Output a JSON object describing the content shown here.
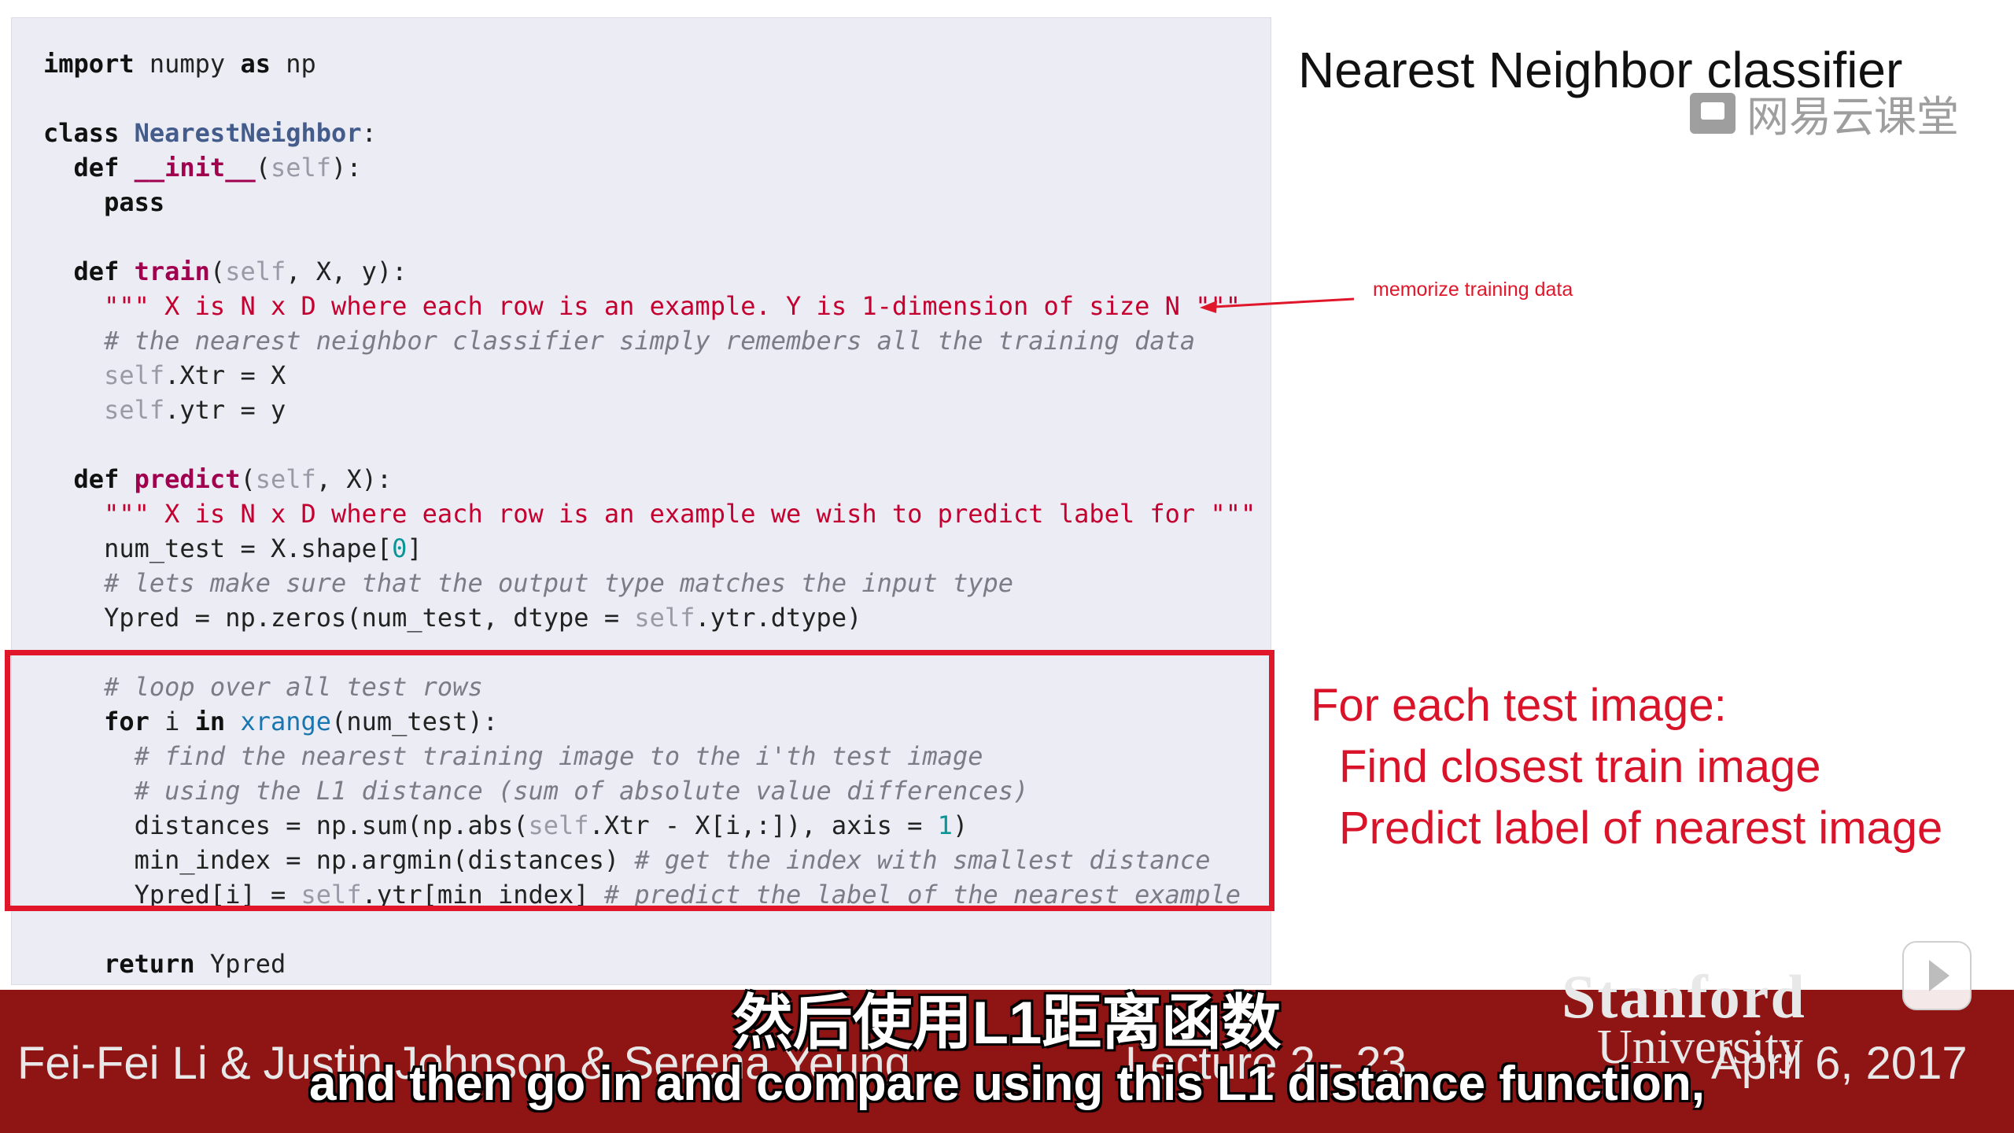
{
  "slide": {
    "title": "Nearest Neighbor classifier",
    "watermark": "网易云课堂",
    "annotation": "memorize training data",
    "side_note": [
      "For each test image:",
      "Find closest train image",
      "Predict label of nearest image"
    ]
  },
  "code_lines": [
    [
      {
        "t": "import",
        "c": "kw"
      },
      {
        "t": " numpy ",
        "c": ""
      },
      {
        "t": "as",
        "c": "kw"
      },
      {
        "t": " np",
        "c": ""
      }
    ],
    [],
    [
      {
        "t": "class",
        "c": "kw"
      },
      {
        "t": " ",
        "c": ""
      },
      {
        "t": "NearestNeighbor",
        "c": "cls"
      },
      {
        "t": ":",
        "c": ""
      }
    ],
    [
      {
        "t": "  ",
        "c": ""
      },
      {
        "t": "def",
        "c": "kw"
      },
      {
        "t": " ",
        "c": ""
      },
      {
        "t": "__init__",
        "c": "fn"
      },
      {
        "t": "(",
        "c": ""
      },
      {
        "t": "self",
        "c": "slf"
      },
      {
        "t": "):",
        "c": ""
      }
    ],
    [
      {
        "t": "    ",
        "c": ""
      },
      {
        "t": "pass",
        "c": "kw"
      }
    ],
    [],
    [
      {
        "t": "  ",
        "c": ""
      },
      {
        "t": "def",
        "c": "kw"
      },
      {
        "t": " ",
        "c": ""
      },
      {
        "t": "train",
        "c": "fn"
      },
      {
        "t": "(",
        "c": ""
      },
      {
        "t": "self",
        "c": "slf"
      },
      {
        "t": ", X, y):",
        "c": ""
      }
    ],
    [
      {
        "t": "    ",
        "c": ""
      },
      {
        "t": "\"\"\" X is N x D where each row is an example. Y is 1-dimension of size N \"\"\"",
        "c": "str"
      }
    ],
    [
      {
        "t": "    ",
        "c": ""
      },
      {
        "t": "# the nearest neighbor classifier simply remembers all the training data",
        "c": "cmt"
      }
    ],
    [
      {
        "t": "    ",
        "c": ""
      },
      {
        "t": "self",
        "c": "slf"
      },
      {
        "t": ".Xtr = X",
        "c": ""
      }
    ],
    [
      {
        "t": "    ",
        "c": ""
      },
      {
        "t": "self",
        "c": "slf"
      },
      {
        "t": ".ytr = y",
        "c": ""
      }
    ],
    [],
    [
      {
        "t": "  ",
        "c": ""
      },
      {
        "t": "def",
        "c": "kw"
      },
      {
        "t": " ",
        "c": ""
      },
      {
        "t": "predict",
        "c": "fn"
      },
      {
        "t": "(",
        "c": ""
      },
      {
        "t": "self",
        "c": "slf"
      },
      {
        "t": ", X):",
        "c": ""
      }
    ],
    [
      {
        "t": "    ",
        "c": ""
      },
      {
        "t": "\"\"\" X is N x D where each row is an example we wish to predict label for \"\"\"",
        "c": "str"
      }
    ],
    [
      {
        "t": "    num_test = X.shape[",
        "c": ""
      },
      {
        "t": "0",
        "c": "num"
      },
      {
        "t": "]",
        "c": ""
      }
    ],
    [
      {
        "t": "    ",
        "c": ""
      },
      {
        "t": "# lets make sure that the output type matches the input type",
        "c": "cmt"
      }
    ],
    [
      {
        "t": "    Ypred = np.zeros(num_test, dtype = ",
        "c": ""
      },
      {
        "t": "self",
        "c": "slf"
      },
      {
        "t": ".ytr.dtype)",
        "c": ""
      }
    ],
    [],
    [
      {
        "t": "    ",
        "c": ""
      },
      {
        "t": "# loop over all test rows",
        "c": "cmt"
      }
    ],
    [
      {
        "t": "    ",
        "c": ""
      },
      {
        "t": "for",
        "c": "kw"
      },
      {
        "t": " i ",
        "c": ""
      },
      {
        "t": "in",
        "c": "kw"
      },
      {
        "t": " ",
        "c": ""
      },
      {
        "t": "xrange",
        "c": "blt"
      },
      {
        "t": "(num_test):",
        "c": ""
      }
    ],
    [
      {
        "t": "      ",
        "c": ""
      },
      {
        "t": "# find the nearest training image to the i'th test image",
        "c": "cmt"
      }
    ],
    [
      {
        "t": "      ",
        "c": ""
      },
      {
        "t": "# using the L1 distance (sum of absolute value differences)",
        "c": "cmt"
      }
    ],
    [
      {
        "t": "      distances = np.sum(np.abs(",
        "c": ""
      },
      {
        "t": "self",
        "c": "slf"
      },
      {
        "t": ".Xtr - X[i,:]), axis = ",
        "c": ""
      },
      {
        "t": "1",
        "c": "num"
      },
      {
        "t": ")",
        "c": ""
      }
    ],
    [
      {
        "t": "      min_index = np.argmin(distances) ",
        "c": ""
      },
      {
        "t": "# get the index with smallest distance",
        "c": "cmt"
      }
    ],
    [
      {
        "t": "      Ypred[i] = ",
        "c": ""
      },
      {
        "t": "self",
        "c": "slf"
      },
      {
        "t": ".ytr[min_index] ",
        "c": ""
      },
      {
        "t": "# predict the label of the nearest example",
        "c": "cmt"
      }
    ],
    [],
    [
      {
        "t": "    ",
        "c": ""
      },
      {
        "t": "return",
        "c": "kw"
      },
      {
        "t": " Ypred",
        "c": ""
      }
    ]
  ],
  "footer": {
    "names": "Fei-Fei Li & Justin Johnson & Serena Yeung",
    "lecture": "Lecture 2 -   23",
    "stanford": "Stanford",
    "university": "University",
    "date": "April 6, 2017"
  },
  "subtitles": {
    "chinese": "然后使用L1距离函数",
    "english": "and then go in and compare using this L1 distance function,"
  },
  "colors": {
    "accent_red": "#e0162a",
    "footer_bg": "#8f1515",
    "code_bg": "#ececf4"
  }
}
